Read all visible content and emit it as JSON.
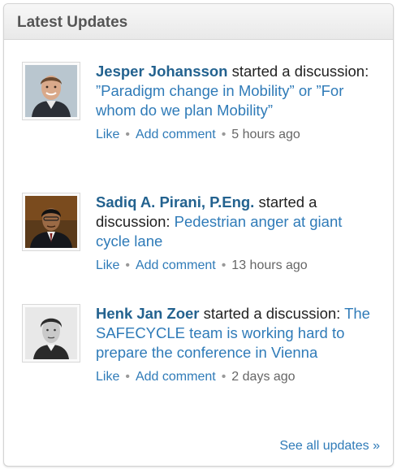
{
  "panel": {
    "title": "Latest Updates",
    "see_all_label": "See all updates »"
  },
  "colors": {
    "link": "#2f7bb8",
    "actor_link": "#23628f",
    "header_text": "#555555",
    "meta_text": "#666666"
  },
  "icons": {
    "separator": "bullet-separator"
  },
  "updates": [
    {
      "actor": "Jesper Johansson",
      "action": " started a discussion: ",
      "topic": "”Paradigm change in Mobility” or ”For whom do we plan Mobility”",
      "like_label": "Like",
      "comment_label": "Add comment",
      "separator": "•",
      "time": "5 hours ago"
    },
    {
      "actor": "Sadiq A. Pirani, P.Eng.",
      "action": " started a discussion: ",
      "topic": "Pedestrian anger at giant cycle lane",
      "like_label": "Like",
      "comment_label": "Add comment",
      "separator": "•",
      "time": "13 hours ago"
    },
    {
      "actor": "Henk Jan Zoer",
      "action": " started a discussion: ",
      "topic": "The SAFECYCLE team is working hard to prepare the conference in Vienna",
      "like_label": "Like",
      "comment_label": "Add comment",
      "separator": "•",
      "time": "2 days ago"
    }
  ]
}
